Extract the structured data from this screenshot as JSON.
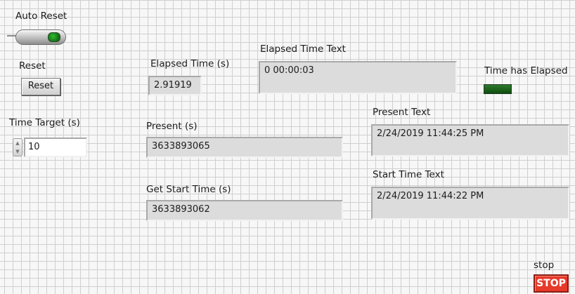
{
  "auto_reset": {
    "label": "Auto Reset",
    "state": true
  },
  "reset": {
    "label": "Reset",
    "button_text": "Reset"
  },
  "time_target": {
    "label": "Time Target (s)",
    "value": "10"
  },
  "elapsed_time": {
    "label": "Elapsed Time (s)",
    "value": "2.91919"
  },
  "elapsed_time_text": {
    "label": "Elapsed Time Text",
    "value": "0  00:00:03"
  },
  "time_has_elapsed": {
    "label": "Time has Elapsed",
    "state": false
  },
  "present": {
    "label": "Present (s)",
    "value": "3633893065"
  },
  "present_text": {
    "label": "Present Text",
    "value": "2/24/2019 11:44:25 PM"
  },
  "get_start_time": {
    "label": "Get Start Time (s)",
    "value": "3633893062"
  },
  "start_time_text": {
    "label": "Start Time Text",
    "value": "2/24/2019 11:44:22 PM"
  },
  "stop": {
    "label": "stop",
    "button_text": "STOP"
  }
}
